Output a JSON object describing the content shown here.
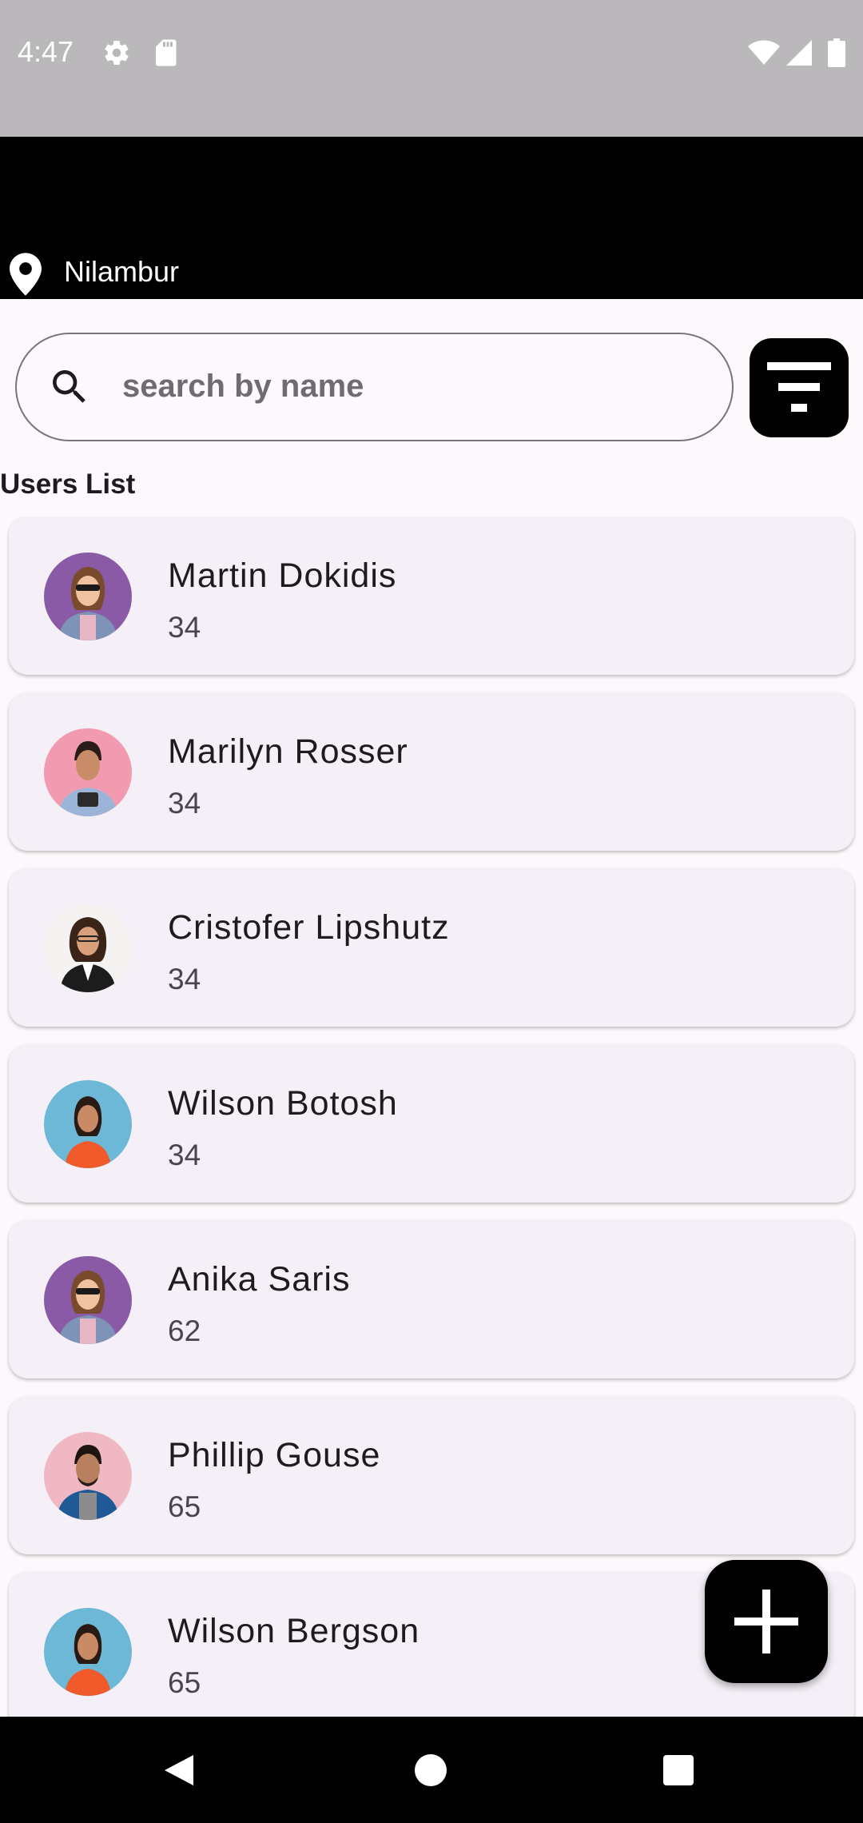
{
  "status_bar": {
    "time": "4:47",
    "icons": [
      "gear-icon",
      "sd-card-icon",
      "wifi-icon",
      "signal-icon",
      "battery-icon"
    ]
  },
  "app_bar": {
    "location": "Nilambur",
    "background": "#000000"
  },
  "search": {
    "placeholder": "search by name",
    "value": ""
  },
  "users_list": {
    "title": "Users List",
    "users": [
      {
        "name": "Martin Dokidis",
        "age": "34"
      },
      {
        "name": "Marilyn Rosser",
        "age": "34"
      },
      {
        "name": "Cristofer Lipshutz",
        "age": "34"
      },
      {
        "name": "Wilson Botosh",
        "age": "34"
      },
      {
        "name": "Anika Saris",
        "age": "62"
      },
      {
        "name": "Phillip Gouse",
        "age": "65"
      },
      {
        "name": "Wilson Bergson",
        "age": "65"
      }
    ]
  },
  "colors": {
    "card_background": "#f5eff7",
    "page_background": "#fdf8fc",
    "accent": "#000000"
  }
}
